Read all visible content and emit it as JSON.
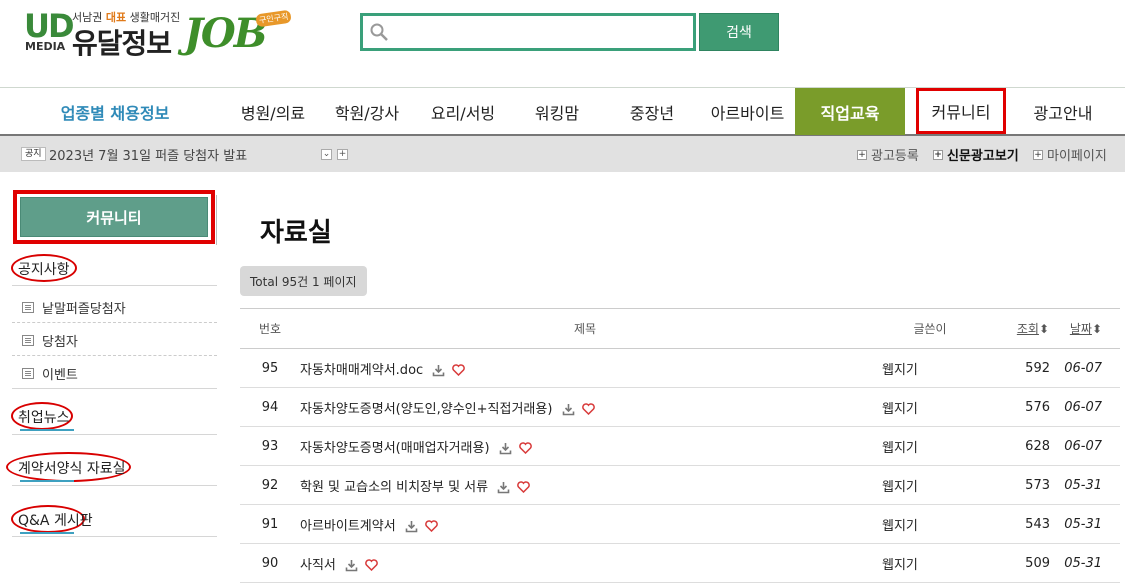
{
  "logo": {
    "ud": "UD",
    "media": "MEDIA",
    "tagline_pre": "서남권 ",
    "tagline_highlight": "대표",
    "tagline_post": " 생활매거진",
    "name": "유달정보",
    "job": "JOB",
    "badge": "구인구직"
  },
  "search": {
    "placeholder": "",
    "button": "검색"
  },
  "nav": {
    "jobtype": "업종별 채용정보",
    "items": [
      "병원/의료",
      "학원/강사",
      "요리/서빙",
      "워킹맘",
      "중장년",
      "아르바이트",
      "직업교육",
      "커뮤니티",
      "광고안내"
    ]
  },
  "notice": {
    "tag": "공지",
    "text": "2023년 7월 31일 퍼즐 당첨자 발표",
    "down": "⌄",
    "plus": "+"
  },
  "util": {
    "ad_register": "광고등록",
    "newspaper": "신문광고보기",
    "mypage": "마이페이지"
  },
  "sidebar": {
    "header": "커뮤니티",
    "notice_title": "공지사항",
    "notice_items": [
      "낱말퍼즐당첨자",
      "당첨자",
      "이벤트"
    ],
    "news_title": "취업뉴스",
    "forms_title": "계약서양식 자료실",
    "qa_title": "Q&A 게시판"
  },
  "main": {
    "title": "자료실",
    "total": "Total 95건 1 페이지",
    "columns": {
      "num": "번호",
      "title": "제목",
      "writer": "글쓴이",
      "views": "조회",
      "date": "날짜"
    },
    "rows": [
      {
        "num": "95",
        "title": "자동차매매계약서.doc",
        "writer": "웹지기",
        "views": "592",
        "date": "06-07"
      },
      {
        "num": "94",
        "title": "자동차양도증명서(양도인,양수인+직접거래용)",
        "writer": "웹지기",
        "views": "576",
        "date": "06-07"
      },
      {
        "num": "93",
        "title": "자동차양도증명서(매매업자거래용)",
        "writer": "웹지기",
        "views": "628",
        "date": "06-07"
      },
      {
        "num": "92",
        "title": "학원 및 교습소의 비치장부 및 서류",
        "writer": "웹지기",
        "views": "573",
        "date": "05-31"
      },
      {
        "num": "91",
        "title": "아르바이트계약서",
        "writer": "웹지기",
        "views": "543",
        "date": "05-31"
      },
      {
        "num": "90",
        "title": "사직서",
        "writer": "웹지기",
        "views": "509",
        "date": "05-31"
      }
    ]
  },
  "colors": {
    "accent": "#3f9a72",
    "nav_active": "#7a9c2a",
    "highlight": "#e00000",
    "link": "#2f8ab8"
  }
}
